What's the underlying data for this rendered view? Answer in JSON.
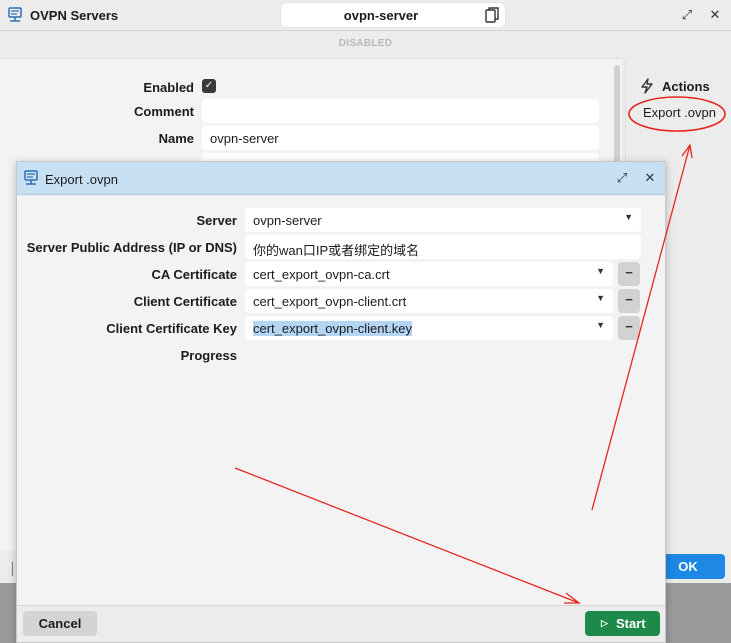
{
  "main_window": {
    "title": "OVPN Servers",
    "name_value": "ovpn-server",
    "status": "DISABLED",
    "fields": {
      "enabled_label": "Enabled",
      "comment_label": "Comment",
      "comment_value": "",
      "name_label": "Name",
      "name_value": "ovpn-server"
    },
    "actions": {
      "title": "Actions",
      "export_label": "Export .ovpn"
    },
    "ok_label": "OK"
  },
  "dialog": {
    "title": "Export .ovpn",
    "fields": {
      "server_label": "Server",
      "server_value": "ovpn-server",
      "address_label": "Server Public Address (IP or DNS)",
      "address_value": "你的wan口IP或者绑定的域名",
      "ca_label": "CA Certificate",
      "ca_value": "cert_export_ovpn-ca.crt",
      "client_cert_label": "Client Certificate",
      "client_cert_value": "cert_export_ovpn-client.crt",
      "client_key_label": "Client Certificate Key",
      "client_key_value": "cert_export_ovpn-client.key",
      "progress_label": "Progress"
    },
    "cancel_label": "Cancel",
    "start_label": "Start"
  },
  "colors": {
    "dialog_title_bg": "#c8e0f4",
    "ok_button": "#1e88e5",
    "start_button": "#1d8a4a",
    "annotation": "#e8251c"
  },
  "icons": [
    "server-icon",
    "copy-icon",
    "restore-icon",
    "close-icon",
    "check-icon",
    "bolt-icon",
    "chevron-down-icon",
    "minus-icon",
    "play-icon"
  ]
}
